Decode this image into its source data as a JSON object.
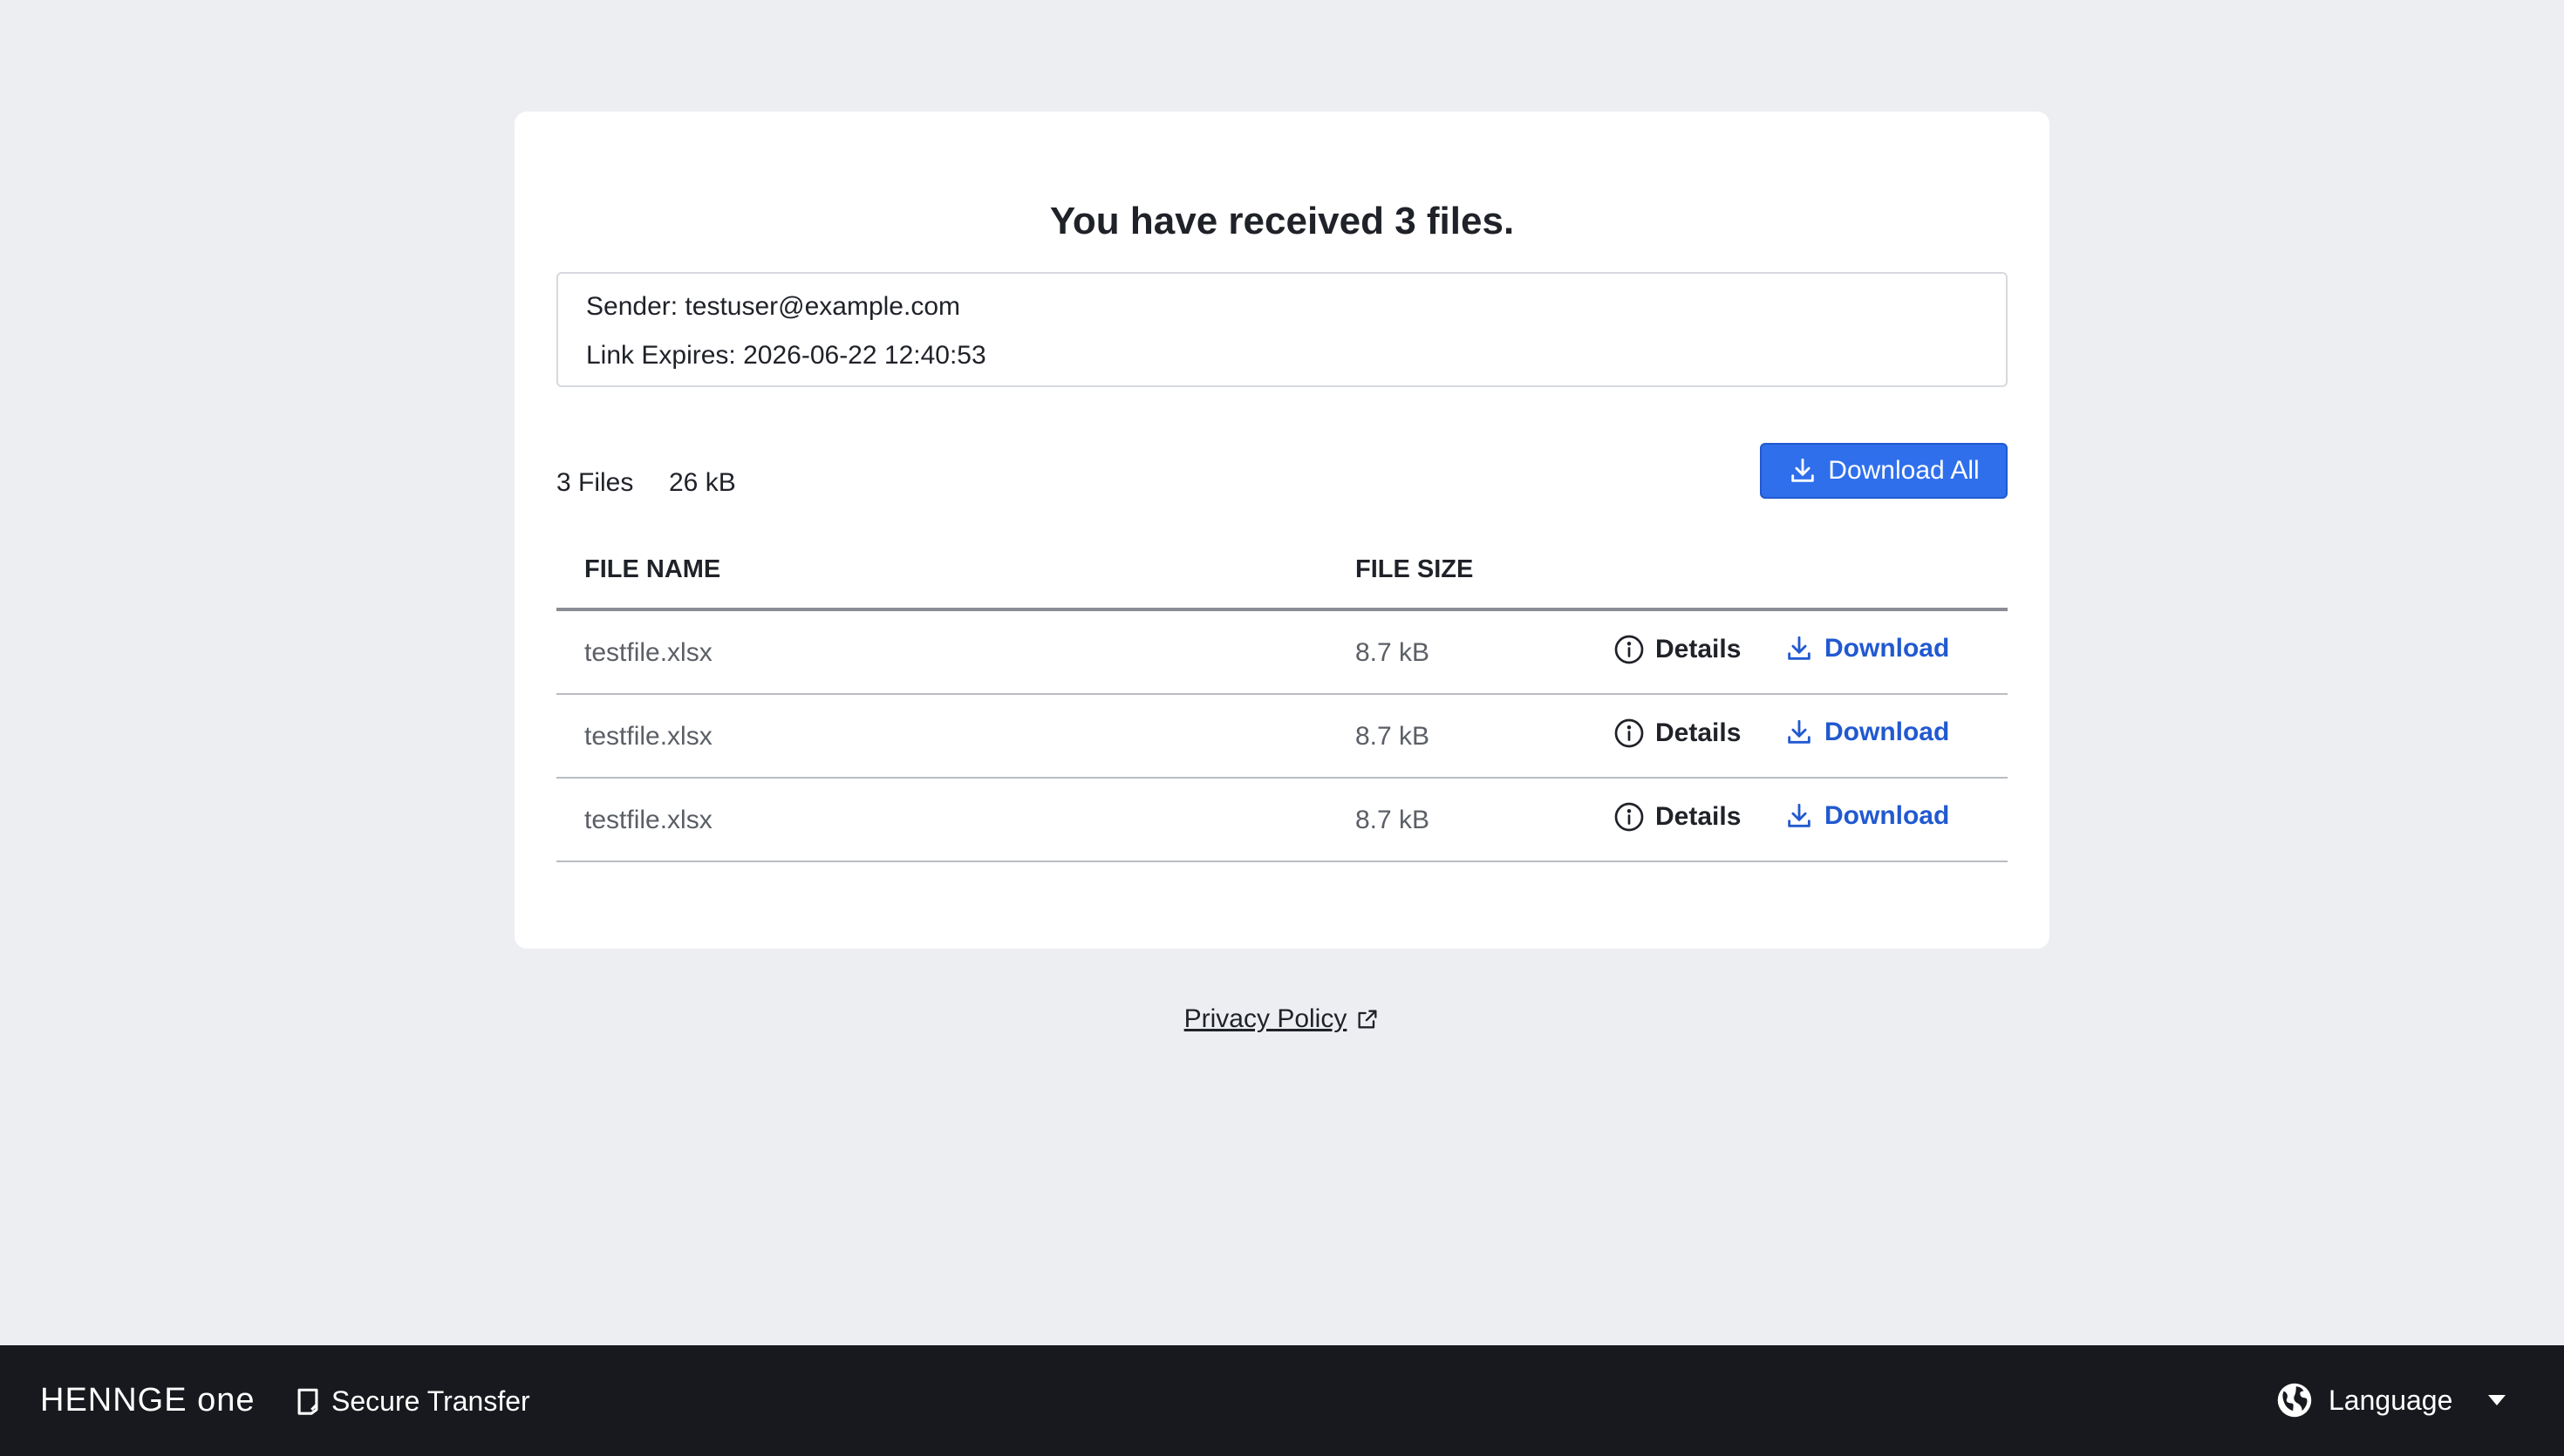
{
  "page": {
    "title": "You have received 3 files."
  },
  "info": {
    "sender_label": "Sender:",
    "sender_value": "testuser@example.com",
    "expires_label": "Link Expires:",
    "expires_value": "2026-06-22 12:40:53"
  },
  "summary": {
    "file_count": "3 Files",
    "total_size": "26 kB"
  },
  "actions": {
    "download_all_label": "Download All",
    "details_label": "Details",
    "download_label": "Download"
  },
  "table": {
    "headers": {
      "file_name": "FILE NAME",
      "file_size": "FILE SIZE"
    },
    "rows": [
      {
        "name": "testfile.xlsx",
        "size": "8.7 kB"
      },
      {
        "name": "testfile.xlsx",
        "size": "8.7 kB"
      },
      {
        "name": "testfile.xlsx",
        "size": "8.7 kB"
      }
    ]
  },
  "links": {
    "privacy_policy": "Privacy Policy"
  },
  "footer": {
    "brand": "HENNGE one",
    "product": "Secure Transfer",
    "language": "Language"
  },
  "icons": {
    "download": "download-icon",
    "info": "info-circle-icon",
    "external": "external-link-icon",
    "globe": "globe-icon",
    "caret": "caret-down-icon",
    "product": "secure-transfer-logo-icon"
  },
  "colors": {
    "primary": "#2f6fec",
    "link_blue": "#2159d0",
    "background": "#edeef2",
    "footer": "#17191e"
  }
}
